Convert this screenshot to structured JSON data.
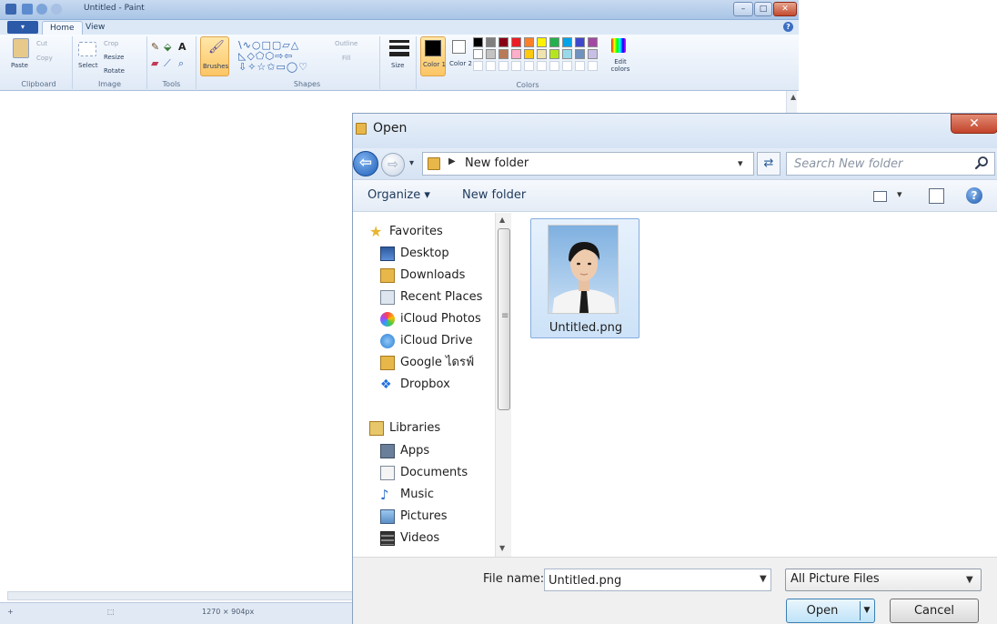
{
  "paint": {
    "title": "Untitled - Paint",
    "tabs": [
      "Home",
      "View"
    ],
    "clipboard": {
      "paste": "Paste",
      "cut": "Cut",
      "copy": "Copy",
      "group": "Clipboard"
    },
    "image": {
      "select": "Select",
      "crop": "Crop",
      "resize": "Resize",
      "rotate": "Rotate",
      "group": "Image"
    },
    "tools": {
      "group": "Tools"
    },
    "brushes": "Brushes",
    "shapes": {
      "outline": "Outline",
      "fill": "Fill",
      "group": "Shapes"
    },
    "size": "Size",
    "colors": {
      "color1": "Color 1",
      "color2": "Color 2",
      "edit": "Edit colors",
      "group": "Colors",
      "palette": [
        "#000000",
        "#7f7f7f",
        "#880015",
        "#ed1c24",
        "#ff7f27",
        "#fff200",
        "#22b14c",
        "#00a2e8",
        "#3f48cc",
        "#a349a4",
        "#ffffff",
        "#c3c3c3",
        "#b97a57",
        "#ffaec9",
        "#ffc90e",
        "#efe4b0",
        "#b5e61d",
        "#99d9ea",
        "#7092be",
        "#c8bfe7"
      ]
    },
    "status": {
      "dimensions": "1270 × 904px"
    }
  },
  "dialog": {
    "title": "Open",
    "path": "New folder",
    "search_placeholder": "Search New folder",
    "toolbar": {
      "organize": "Organize ▾",
      "new_folder": "New folder"
    },
    "nav": {
      "favorites_header": "Favorites",
      "favorites": [
        "Desktop",
        "Downloads",
        "Recent Places",
        "iCloud Photos",
        "iCloud Drive",
        "Google ไดรฟ์",
        "Dropbox"
      ],
      "libraries_header": "Libraries",
      "libraries": [
        "Apps",
        "Documents",
        "Music",
        "Pictures",
        "Videos"
      ]
    },
    "files": [
      {
        "name": "Untitled.png"
      }
    ],
    "footer": {
      "file_name_label": "File name:",
      "file_name_value": "Untitled.png",
      "file_type": "All Picture Files",
      "open": "Open",
      "cancel": "Cancel"
    }
  }
}
